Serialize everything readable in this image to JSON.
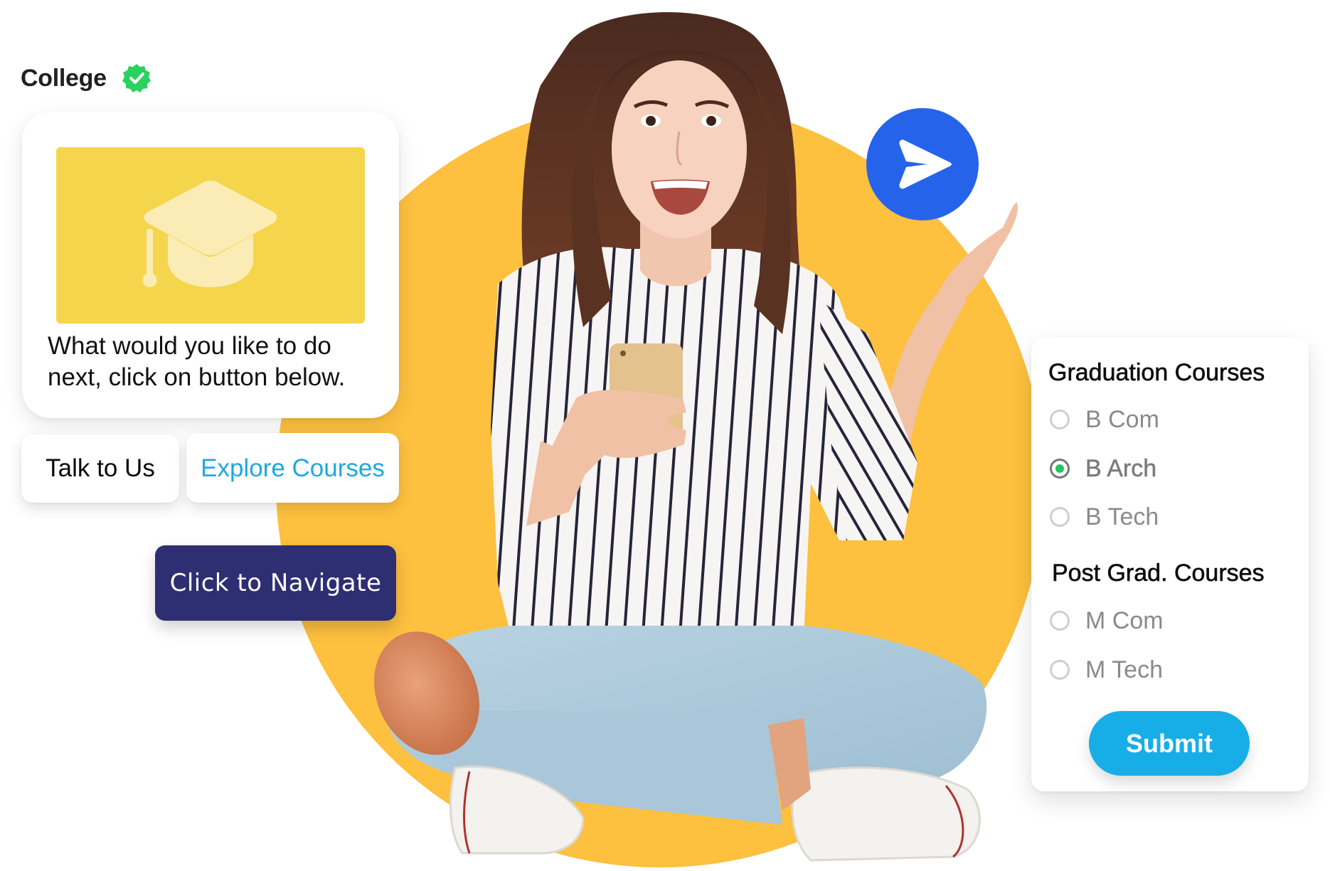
{
  "colors": {
    "circle": "#fdc03f",
    "image_bg": "#f5d54b",
    "cap": "#faecb4",
    "badge": "#2bd15f",
    "send": "#2563eb",
    "navy": "#2e2f72",
    "explore_text": "#1fa8e0",
    "submit": "#17aee8",
    "radio_checked": "#22c55e"
  },
  "header": {
    "brand_name": "College",
    "verified_icon": "verified-badge-icon"
  },
  "chat": {
    "image_icon": "graduation-cap-icon",
    "message": "What would you like to do next, click on button below.",
    "quick_replies": [
      {
        "label": "Talk to Us"
      },
      {
        "label": "Explore Courses"
      }
    ],
    "navigate_label": "Click to Navigate",
    "send_icon": "send-icon"
  },
  "course_form": {
    "groups": [
      {
        "title": "Graduation Courses",
        "options": [
          {
            "label": "B Com",
            "checked": false
          },
          {
            "label": "B Arch",
            "checked": true
          },
          {
            "label": "B Tech",
            "checked": false
          }
        ]
      },
      {
        "title": "Post Grad. Courses",
        "options": [
          {
            "label": "M Com",
            "checked": false
          },
          {
            "label": "M Tech",
            "checked": false
          }
        ]
      }
    ],
    "submit_label": "Submit"
  },
  "hero_image": {
    "subject": "smiling student sitting cross-legged holding a smartphone"
  }
}
